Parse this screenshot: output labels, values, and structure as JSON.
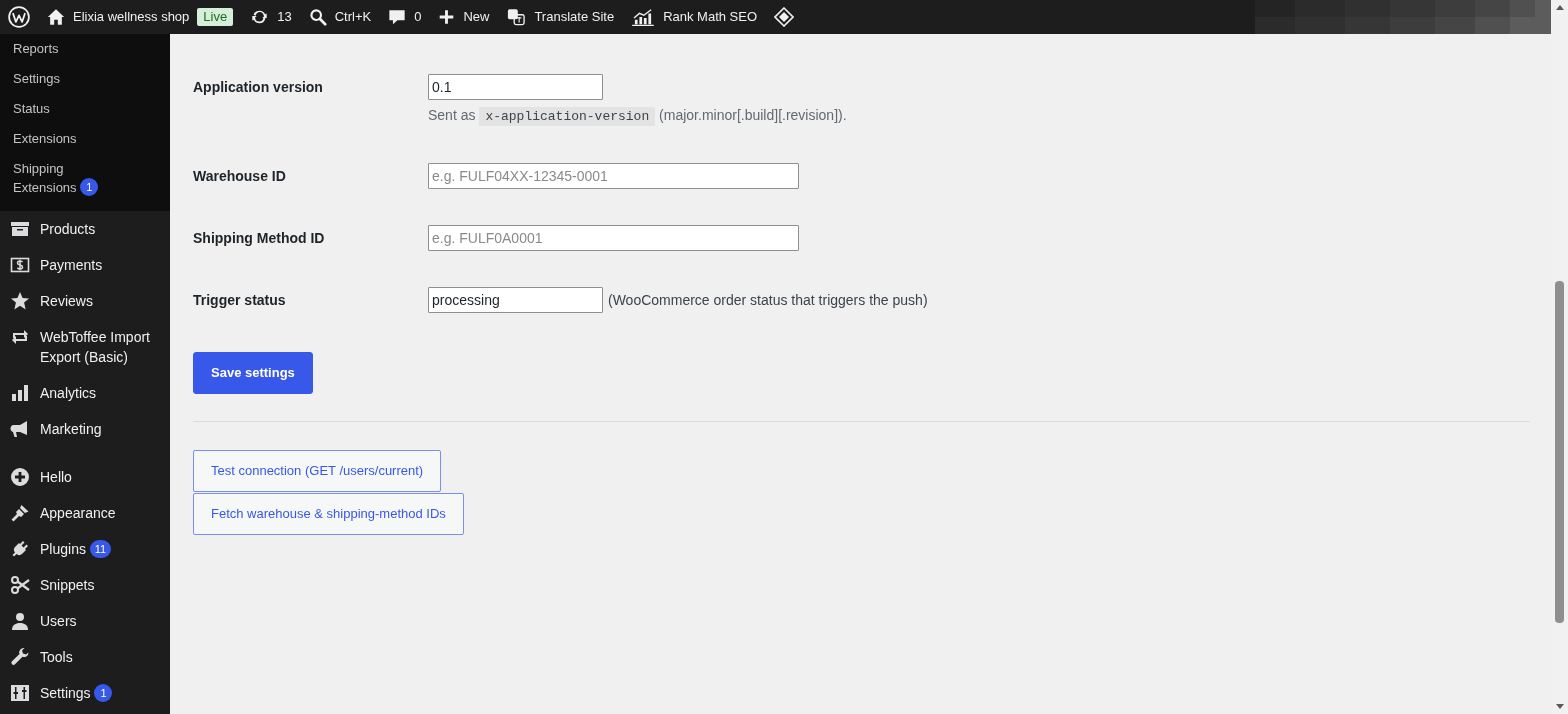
{
  "admin_bar": {
    "site_name": "Elixia wellness shop",
    "environment_badge": "Live",
    "updates_count": "13",
    "search_shortcut": "Ctrl+K",
    "comments_count": "0",
    "new_label": "New",
    "translate_label": "Translate Site",
    "seo_label": "Rank Math SEO"
  },
  "sidebar": {
    "submenu": [
      {
        "label": "Reports"
      },
      {
        "label": "Settings"
      },
      {
        "label": "Status"
      },
      {
        "label": "Extensions"
      },
      {
        "label": "Shipping Extensions",
        "badge": "1"
      }
    ],
    "menu_groups": [
      {
        "items": [
          {
            "label": "Products"
          },
          {
            "label": "Payments"
          },
          {
            "label": "Reviews"
          },
          {
            "label": "WebToffee Import Export (Basic)"
          },
          {
            "label": "Analytics"
          },
          {
            "label": "Marketing"
          }
        ]
      },
      {
        "items": [
          {
            "label": "Hello"
          },
          {
            "label": "Appearance"
          },
          {
            "label": "Plugins",
            "badge": "11"
          },
          {
            "label": "Snippets"
          },
          {
            "label": "Users"
          },
          {
            "label": "Tools"
          },
          {
            "label": "Settings",
            "badge": "1"
          }
        ]
      }
    ]
  },
  "settings_form": {
    "fields": [
      {
        "label": "Application version",
        "kind": "short",
        "value": "0.1",
        "description": {
          "before": "Sent as",
          "code": "x-application-version",
          "after": "(major.minor[.build][.revision])."
        }
      },
      {
        "label": "Warehouse ID",
        "kind": "wide",
        "placeholder": "e.g. FULF04XX-12345-0001"
      },
      {
        "label": "Shipping Method ID",
        "kind": "wide",
        "placeholder": "e.g. FULF0A0001"
      },
      {
        "label": "Trigger status",
        "kind": "short",
        "value": "processing",
        "hint": "(WooCommerce order status that triggers the push)"
      }
    ],
    "save_button": "Save settings"
  },
  "tools": {
    "buttons": [
      "Test connection (GET /users/current)",
      "Fetch warehouse & shipping-method IDs"
    ]
  }
}
